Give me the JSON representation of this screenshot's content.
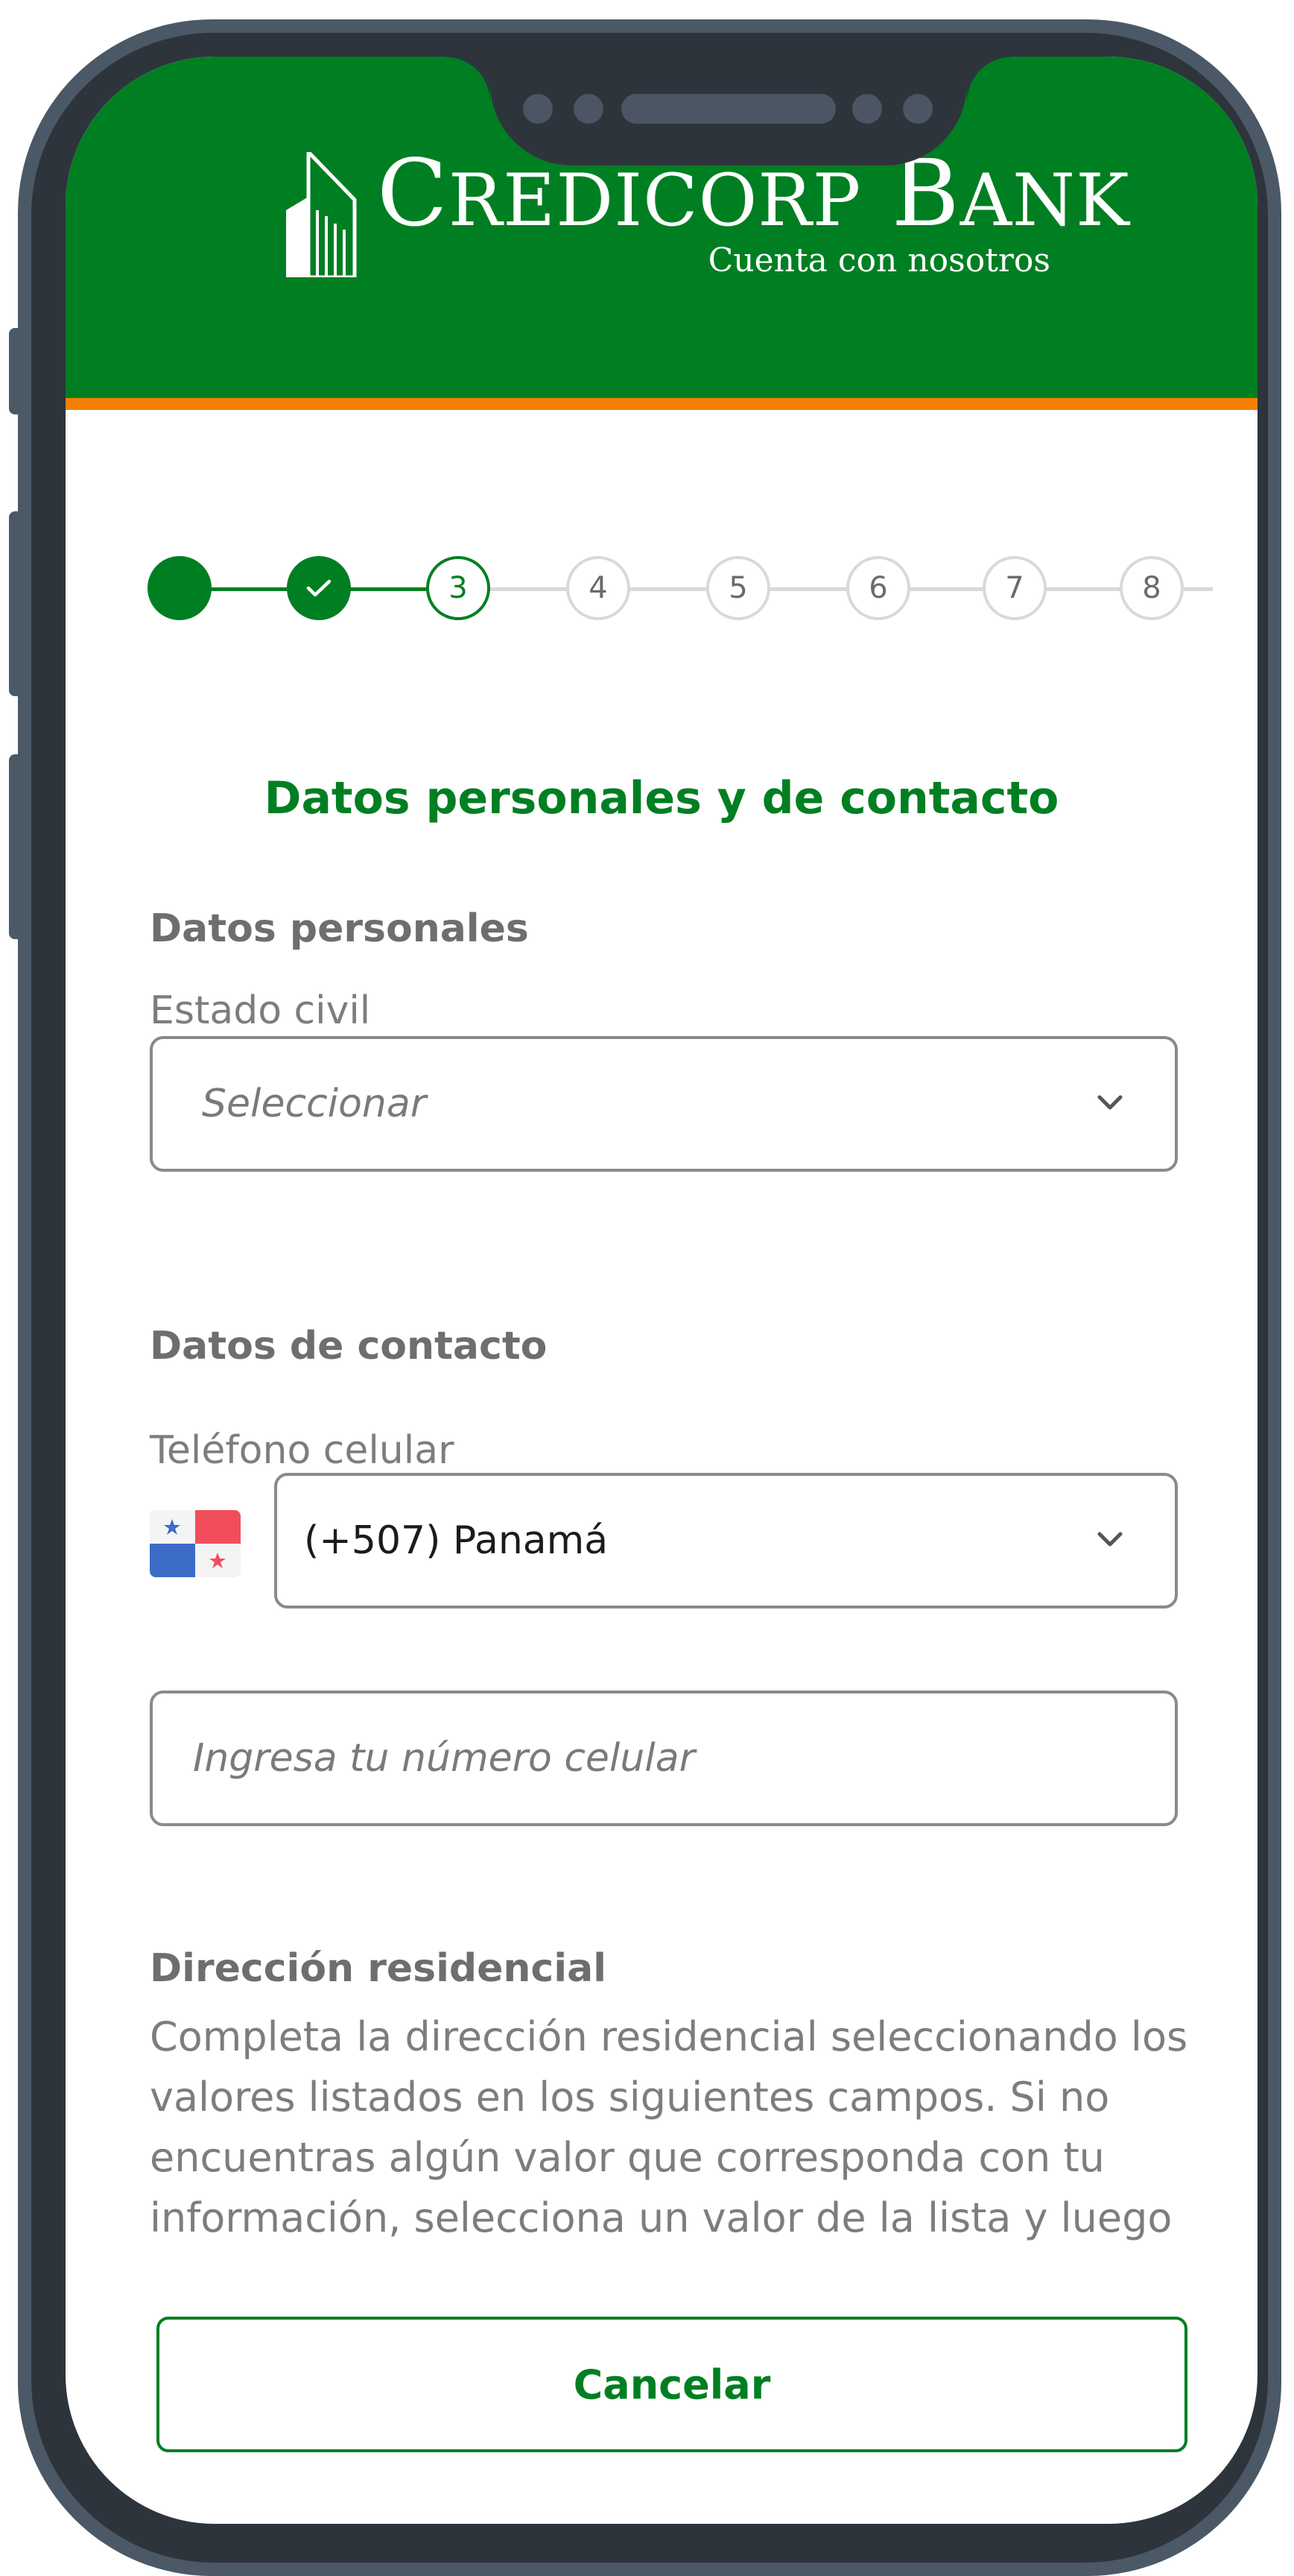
{
  "header": {
    "brand": {
      "big_c": "C",
      "rest1": "REDICORP",
      "big_b": "B",
      "rest2": "ANK"
    },
    "tagline": "Cuenta con nosotros",
    "colors": {
      "brand_green": "#007f22",
      "accent_orange": "#f57f00"
    }
  },
  "stepper": {
    "steps": [
      {
        "label": "",
        "state": "done"
      },
      {
        "label": "✓",
        "state": "done"
      },
      {
        "label": "3",
        "state": "current"
      },
      {
        "label": "4",
        "state": "pending"
      },
      {
        "label": "5",
        "state": "pending"
      },
      {
        "label": "6",
        "state": "pending"
      },
      {
        "label": "7",
        "state": "pending"
      },
      {
        "label": "8",
        "state": "pending"
      }
    ]
  },
  "page_title": "Datos personales y de contacto",
  "personal": {
    "heading": "Datos personales",
    "civil_status_label": "Estado civil",
    "civil_status_placeholder": "Seleccionar"
  },
  "contact": {
    "heading": "Datos de contacto",
    "phone_label": "Teléfono celular",
    "country_value": "(+507) Panamá",
    "phone_placeholder": "Ingresa tu número celular"
  },
  "address": {
    "heading": "Dirección residencial",
    "description": "Completa la dirección residencial seleccionando los valores listados en los siguientes campos. Si no encuentras algún valor que corresponda con tu información, selecciona un valor de la lista y luego modifícala escribiendo tu información en el campo de"
  },
  "footer": {
    "cancel_label": "Cancelar"
  },
  "icons": {
    "check": "check-icon",
    "chevron": "chevron-down-icon",
    "flag": "panama-flag-icon",
    "logo": "building-logo-icon"
  }
}
